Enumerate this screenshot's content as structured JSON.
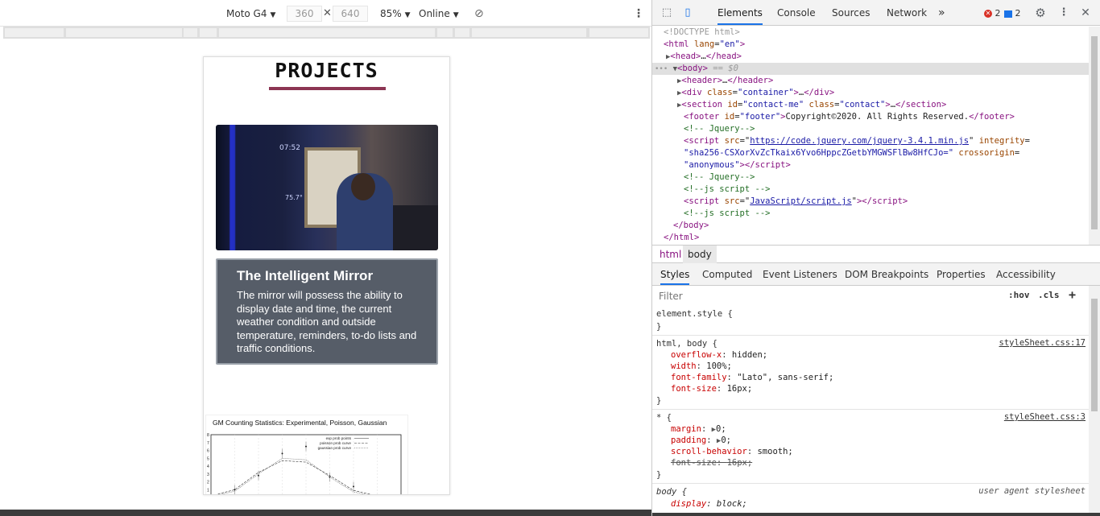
{
  "device_toolbar": {
    "device": "Moto G4",
    "width": "360",
    "height": "640",
    "zoom": "85%",
    "throttle": "Online"
  },
  "page": {
    "heading": "PROJECTS",
    "accent_color": "#8c3553",
    "mirror_clock": "07:52",
    "mirror_temp": "75.7°",
    "project": {
      "title": "The Intelligent Mirror",
      "description": "The mirror will possess the ability to display date and time, the current weather condition and outside temperature, reminders, to-do lists and traffic conditions."
    }
  },
  "devtools": {
    "tabs": [
      "Elements",
      "Console",
      "Sources",
      "Network"
    ],
    "active_tab": "Elements",
    "more_tabs": "»",
    "error_count": "2",
    "message_count": "2",
    "dom": {
      "doctype": "<!DOCTYPE html>",
      "html_open_tag": "html",
      "lang_attr": "lang",
      "lang_val": "\"en\"",
      "head": "head",
      "body": "body",
      "body_marker": "== $0",
      "header": "header",
      "div": "div",
      "class_attr": "class",
      "container_val": "\"container\"",
      "section": "section",
      "id_attr": "id",
      "contact_me_val": "\"contact-me\"",
      "contact_val": "\"contact\"",
      "footer": "footer",
      "footer_id_val": "\"footer\"",
      "footer_text": "Copyright©2020. All Rights Reserved.",
      "comment_jquery": "<!--        Jquery-->",
      "script": "script",
      "src_attr": "src",
      "jquery_src": "https://code.jquery.com/jquery-3.4.1.min.js",
      "integrity_attr": "integrity",
      "integrity_val": "\"sha256-CSXorXvZcTkaix6Yvo6HppcZGetbYMGWSFlBw8HfCJo=\"",
      "crossorigin_attr": "crossorigin",
      "anonymous_val": "\"anonymous\"",
      "comment_js": "<!--js script       -->",
      "script_src": "JavaScript/script.js",
      "ellipsis": "…"
    },
    "breadcrumbs": [
      "html",
      "body"
    ],
    "styles_tabs": [
      "Styles",
      "Computed",
      "Event Listeners",
      "DOM Breakpoints",
      "Properties",
      "Accessibility"
    ],
    "filter_placeholder": "Filter",
    "hov_label": ":hov",
    "cls_label": ".cls",
    "plus_label": "+",
    "rules": {
      "element_style": "element.style {",
      "close": "}",
      "html_body_selector": "html, body {",
      "html_body_source": "styleSheet.css:17",
      "html_body_props": [
        {
          "name": "overflow-x",
          "value": "hidden;"
        },
        {
          "name": "width",
          "value": "100%;"
        },
        {
          "name": "font-family",
          "value": "\"Lato\", sans-serif;"
        },
        {
          "name": "font-size",
          "value": "16px;"
        }
      ],
      "star_selector": "* {",
      "star_source": "styleSheet.css:3",
      "star_props": [
        {
          "name": "margin",
          "value": "0;"
        },
        {
          "name": "padding",
          "value": "0;"
        },
        {
          "name": "scroll-behavior",
          "value": "smooth;"
        },
        {
          "name": "font-size",
          "value": "16px;"
        }
      ],
      "body_selector": "body {",
      "body_source": "user agent stylesheet",
      "body_props": [
        {
          "name": "display",
          "value": "block;"
        }
      ]
    }
  },
  "chart_data": {
    "type": "line",
    "title": "GM Counting Statistics: Experimental, Poisson, Gaussian",
    "xlabel": "",
    "ylabel": "",
    "ylim": [
      0,
      8
    ],
    "y_ticks": [
      "1",
      "2",
      "3",
      "4",
      "5",
      "6",
      "7",
      "8"
    ],
    "legend": "top-right",
    "series": [
      {
        "name": "exp prob points",
        "x": [
          1,
          2,
          3,
          4,
          5,
          6
        ],
        "values": [
          1.0,
          2.8,
          5.6,
          6.5,
          2.6,
          1.4
        ]
      },
      {
        "name": "poisson prob curve",
        "x": [
          0,
          1,
          2,
          3,
          4,
          5,
          6,
          7
        ],
        "values": [
          0.2,
          1.0,
          3.2,
          4.7,
          4.5,
          2.8,
          0.9,
          0.2
        ]
      },
      {
        "name": "gaussian prob curve",
        "x": [
          0,
          1,
          2,
          3,
          4,
          5,
          6,
          7
        ],
        "values": [
          0.1,
          0.8,
          3.0,
          5.0,
          4.8,
          2.6,
          0.7,
          0.1
        ]
      }
    ]
  }
}
